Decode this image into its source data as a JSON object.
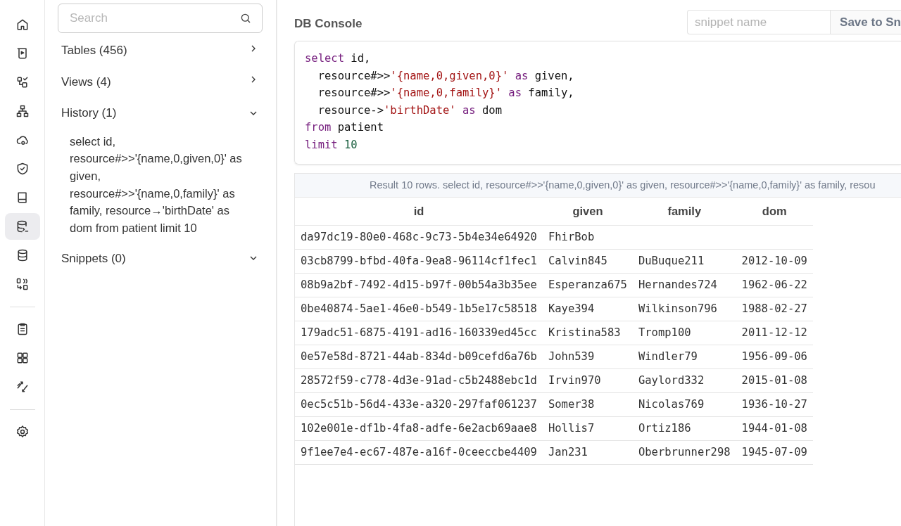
{
  "rail": {
    "groups": [
      [
        {
          "selected": false
        },
        {
          "selected": false
        },
        {
          "selected": false
        },
        {
          "selected": false
        },
        {
          "selected": false
        },
        {
          "selected": false
        },
        {
          "selected": false
        },
        {
          "selected": true
        },
        {
          "selected": false
        },
        {
          "selected": false
        }
      ],
      [
        {
          "selected": false
        },
        {
          "selected": false
        },
        {
          "selected": false
        }
      ],
      [
        {
          "selected": false
        }
      ]
    ]
  },
  "panel": {
    "search": {
      "placeholder": "Search"
    },
    "sections": [
      {
        "label": "Tables (456)",
        "expanded": false
      },
      {
        "label": "Views (4)",
        "expanded": false
      },
      {
        "label": "History (1)",
        "expanded": true,
        "items": [
          "select id, resource#>>'{name,0,given,0}' as given, resource#>>'{name,0,family}' as family, resource→'birthDate' as dom from patient limit 10"
        ]
      },
      {
        "label": "Snippets (0)",
        "expanded": true
      }
    ]
  },
  "main": {
    "title": "DB Console",
    "snippet": {
      "placeholder": "snippet name"
    },
    "save_button": "Save to Sn",
    "editor": {
      "lines": [
        [
          {
            "kind": "keyword",
            "text": "select"
          },
          {
            "kind": "plain",
            "text": " id,"
          }
        ],
        [
          {
            "kind": "plain",
            "text": "  resource#>>"
          },
          {
            "kind": "string",
            "text": "'{name,0,given,0}'"
          },
          {
            "kind": "keyword",
            "text": " as"
          },
          {
            "kind": "plain",
            "text": " given,"
          }
        ],
        [
          {
            "kind": "plain",
            "text": "  resource#>>"
          },
          {
            "kind": "string",
            "text": "'{name,0,family}'"
          },
          {
            "kind": "keyword",
            "text": " as"
          },
          {
            "kind": "plain",
            "text": " family,"
          }
        ],
        [
          {
            "kind": "plain",
            "text": "  resource->"
          },
          {
            "kind": "string",
            "text": "'birthDate'"
          },
          {
            "kind": "keyword",
            "text": " as"
          },
          {
            "kind": "plain",
            "text": " dom"
          }
        ],
        [
          {
            "kind": "keyword",
            "text": "from"
          },
          {
            "kind": "plain",
            "text": " patient"
          }
        ],
        [
          {
            "kind": "keyword",
            "text": "limit"
          },
          {
            "kind": "number",
            "text": " 10"
          }
        ]
      ]
    },
    "result": {
      "summary": "Result 10 rows. select id, resource#>>'{name,0,given,0}' as given, resource#>>'{name,0,family}' as family, resou",
      "columns": [
        "id",
        "given",
        "family",
        "dom"
      ],
      "rows": [
        [
          "da97dc19-80e0-468c-9c73-5b4e34e64920",
          "FhirBob",
          null,
          null
        ],
        [
          "03cb8799-bfbd-40fa-9ea8-96114cf1fec1",
          "Calvin845",
          "DuBuque211",
          "2012-10-09"
        ],
        [
          "08b9a2bf-7492-4d15-b97f-00b54a3b35ee",
          "Esperanza675",
          "Hernandes724",
          "1962-06-22"
        ],
        [
          "0be40874-5ae1-46e0-b549-1b5e17c58518",
          "Kaye394",
          "Wilkinson796",
          "1988-02-27"
        ],
        [
          "179adc51-6875-4191-ad16-160339ed45cc",
          "Kristina583",
          "Tromp100",
          "2011-12-12"
        ],
        [
          "0e57e58d-8721-44ab-834d-b09cefd6a76b",
          "John539",
          "Windler79",
          "1956-09-06"
        ],
        [
          "28572f59-c778-4d3e-91ad-c5b2488ebc1d",
          "Irvin970",
          "Gaylord332",
          "2015-01-08"
        ],
        [
          "0ec5c51b-56d4-433e-a320-297faf061237",
          "Somer38",
          "Nicolas769",
          "1936-10-27"
        ],
        [
          "102e001e-df1b-4fa8-adfe-6e2acb69aae8",
          "Hollis7",
          "Ortiz186",
          "1944-01-08"
        ],
        [
          "9f1ee7e4-ec67-487e-a16f-0ceeccbe4409",
          "Jan231",
          "Oberbrunner298",
          "1945-07-09"
        ]
      ]
    }
  }
}
